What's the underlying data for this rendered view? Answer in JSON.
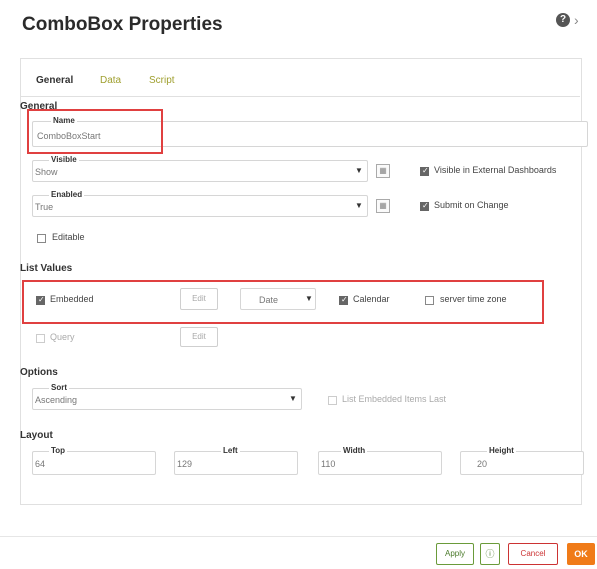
{
  "dialog": {
    "title": "ComboBox Properties",
    "help_glyph": "?"
  },
  "tabs": [
    "General",
    "Data",
    "Script"
  ],
  "general": {
    "section_label": "General",
    "name": {
      "label": "Name",
      "value": "ComboBoxStart"
    },
    "visible": {
      "label": "Visible",
      "value": "Show"
    },
    "visible_external": {
      "label": "Visible in External Dashboards",
      "checked": true
    },
    "enabled": {
      "label": "Enabled",
      "value": "True"
    },
    "submit_on_change": {
      "label": "Submit on Change",
      "checked": true
    },
    "editable": {
      "label": "Editable",
      "checked": false
    }
  },
  "list_values": {
    "section_label": "List Values",
    "embedded": {
      "label": "Embedded",
      "checked": true,
      "edit_label": "Edit"
    },
    "type_select": "Date",
    "calendar": {
      "label": "Calendar",
      "checked": true
    },
    "server_time_zone": {
      "label": "server time zone",
      "checked": false
    },
    "query": {
      "label": "Query",
      "checked": false,
      "edit_label": "Edit"
    }
  },
  "options": {
    "section_label": "Options",
    "sort": {
      "label": "Sort",
      "value": "Ascending"
    },
    "list_embedded_last": {
      "label": "List Embedded Items Last",
      "checked": false
    }
  },
  "layout": {
    "section_label": "Layout",
    "fields": [
      {
        "label": "Top",
        "value": "64"
      },
      {
        "label": "Left",
        "value": "129"
      },
      {
        "label": "Width",
        "value": "110"
      },
      {
        "label": "Height",
        "value": "20"
      }
    ]
  },
  "footer": {
    "apply": "Apply",
    "cancel": "Cancel",
    "ok": "OK"
  },
  "colors": {
    "ok": "#f07b18",
    "highlight": "#e04040",
    "apply_border": "#6a9b3a"
  }
}
